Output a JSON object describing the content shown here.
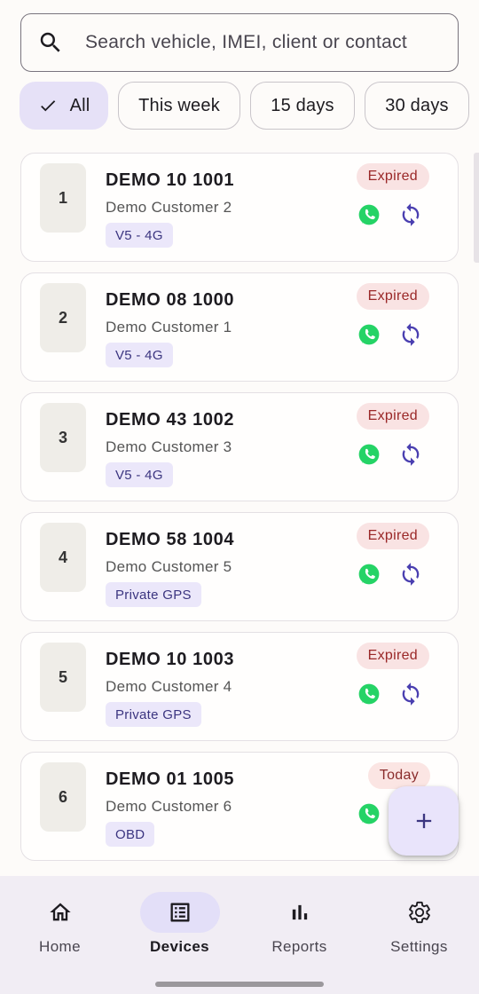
{
  "search": {
    "placeholder": "Search vehicle, IMEI, client or contact"
  },
  "filters": [
    {
      "label": "All",
      "selected": true
    },
    {
      "label": "This week",
      "selected": false
    },
    {
      "label": "15 days",
      "selected": false
    },
    {
      "label": "30 days",
      "selected": false
    }
  ],
  "devices": [
    {
      "index": "1",
      "plate": "DEMO 10 1001",
      "customer": "Demo Customer 2",
      "model": "V5 - 4G",
      "status": "Expired"
    },
    {
      "index": "2",
      "plate": "DEMO 08 1000",
      "customer": "Demo Customer 1",
      "model": "V5 - 4G",
      "status": "Expired"
    },
    {
      "index": "3",
      "plate": "DEMO 43 1002",
      "customer": "Demo Customer 3",
      "model": "V5 - 4G",
      "status": "Expired"
    },
    {
      "index": "4",
      "plate": "DEMO 58 1004",
      "customer": "Demo Customer 5",
      "model": "Private GPS",
      "status": "Expired"
    },
    {
      "index": "5",
      "plate": "DEMO 10 1003",
      "customer": "Demo Customer 4",
      "model": "Private GPS",
      "status": "Expired"
    },
    {
      "index": "6",
      "plate": "DEMO 01 1005",
      "customer": "Demo Customer 6",
      "model": "OBD",
      "status": "Today"
    }
  ],
  "nav": {
    "home": "Home",
    "devices": "Devices",
    "reports": "Reports",
    "settings": "Settings",
    "active": "Devices"
  },
  "colors": {
    "accent": "#3b3580",
    "whatsapp": "#25d366",
    "expired_bg": "#f9e3e3",
    "expired_text": "#9a2828"
  }
}
